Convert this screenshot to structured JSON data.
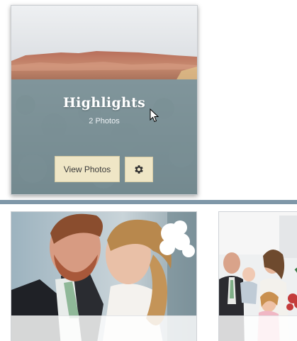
{
  "album": {
    "title": "Highlights",
    "photo_count": "2 Photos",
    "view_button_label": "View Photos",
    "settings_icon": "gear-icon"
  },
  "colors": {
    "button_bg": "#efe6c6",
    "overlay": "#788e9e",
    "divider": "#7f97a8"
  },
  "photos": [
    {
      "subject": "wedding-couple-photo"
    },
    {
      "subject": "family-group-photo"
    }
  ]
}
